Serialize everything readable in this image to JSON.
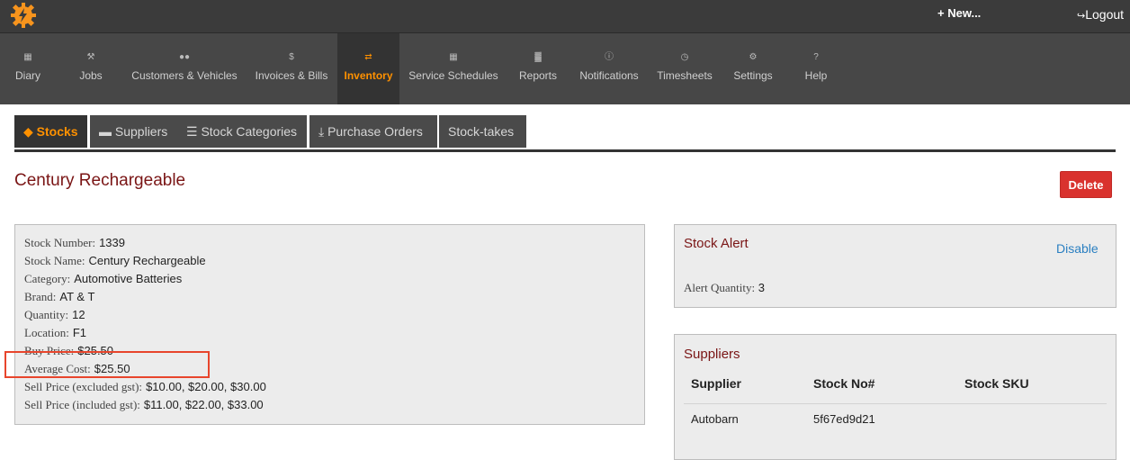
{
  "topbar": {
    "logo_icon": "gear-lightning-logo",
    "new_label": "+ New...",
    "logout_label": "Logout",
    "logout_icon": "logout-icon"
  },
  "nav": {
    "items": [
      {
        "id": "diary",
        "label": "Diary",
        "icon": "calendar-icon"
      },
      {
        "id": "jobs",
        "label": "Jobs",
        "icon": "wrench-icon"
      },
      {
        "id": "customers",
        "label": "Customers & Vehicles",
        "icon": "users-icon"
      },
      {
        "id": "invoices",
        "label": "Invoices & Bills",
        "icon": "dollar-icon"
      },
      {
        "id": "inventory",
        "label": "Inventory",
        "icon": "exchange-icon",
        "active": true
      },
      {
        "id": "schedules",
        "label": "Service Schedules",
        "icon": "calendar-icon"
      },
      {
        "id": "reports",
        "label": "Reports",
        "icon": "chart-icon"
      },
      {
        "id": "notifications",
        "label": "Notifications",
        "icon": "info-icon"
      },
      {
        "id": "timesheets",
        "label": "Timesheets",
        "icon": "clock-icon"
      },
      {
        "id": "settings",
        "label": "Settings",
        "icon": "gears-icon"
      },
      {
        "id": "help",
        "label": "Help",
        "icon": "question-icon"
      }
    ],
    "active_color": "#ff9100"
  },
  "tabs": [
    {
      "label": "Stocks",
      "icon": "tags-icon",
      "active": true
    },
    {
      "label": "Suppliers",
      "icon": "truck-icon"
    },
    {
      "label": "Stock Categories",
      "icon": "list-icon"
    },
    {
      "label": "Purchase Orders",
      "icon": "download-icon"
    },
    {
      "label": "Stock-takes",
      "icon": ""
    }
  ],
  "page": {
    "title": "Century Rechargeable",
    "delete_label": "Delete"
  },
  "details": [
    {
      "key": "Stock Number:",
      "value": "1339"
    },
    {
      "key": "Stock Name:",
      "value": "Century Rechargeable"
    },
    {
      "key": "Category:",
      "value": "Automotive Batteries"
    },
    {
      "key": "Brand:",
      "value": "AT & T"
    },
    {
      "key": "Quantity:",
      "value": "12"
    },
    {
      "key": "Location:",
      "value": "F1"
    },
    {
      "key": "Buy Price:",
      "value": "$25.50"
    },
    {
      "key": "Average Cost:",
      "value": "$25.50"
    },
    {
      "key": "Sell Price (excluded gst):",
      "value": "$10.00, $20.00, $30.00"
    },
    {
      "key": "Sell Price (included gst):",
      "value": "$11.00, $22.00, $33.00"
    }
  ],
  "stock_alert": {
    "title": "Stock Alert",
    "disable_label": "Disable",
    "quantity_key": "Alert Quantity:",
    "quantity_value": "3"
  },
  "suppliers": {
    "title": "Suppliers",
    "columns": [
      "Supplier",
      "Stock No#",
      "Stock SKU"
    ],
    "rows": [
      [
        "Autobarn",
        "5f67ed9d21",
        ""
      ]
    ]
  },
  "colors": {
    "title_red": "#7a1515",
    "delete_red": "#d9322e",
    "highlight": "#e8452c",
    "link_blue": "#2a7fc1"
  }
}
